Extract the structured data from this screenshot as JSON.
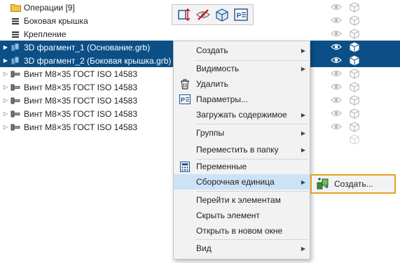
{
  "tree": {
    "rows": [
      {
        "label": "Операции [9]",
        "icon": "folder-icon"
      },
      {
        "label": "Боковая крышка",
        "icon": "list-icon"
      },
      {
        "label": "Крепление",
        "icon": "list-icon"
      },
      {
        "label": "3D фрагмент_1 (Основание.grb)",
        "icon": "fragment-3d-icon"
      },
      {
        "label": "3D фрагмент_2 (Боковая крышка.grb)",
        "icon": "fragment-3d-icon"
      },
      {
        "label": "Винт M8×35 ГОСТ ISO 14583",
        "icon": "screw-icon"
      },
      {
        "label": "Винт M8×35 ГОСТ ISO 14583",
        "icon": "screw-icon"
      },
      {
        "label": "Винт M8×35 ГОСТ ISO 14583",
        "icon": "screw-icon"
      },
      {
        "label": "Винт M8×35 ГОСТ ISO 14583",
        "icon": "screw-icon"
      },
      {
        "label": "Винт M8×35 ГОСТ ISO 14583",
        "icon": "screw-icon"
      }
    ]
  },
  "toolbar": {
    "buttons": [
      "transform-icon",
      "hide-icon",
      "cube-view-icon",
      "parameters-icon"
    ]
  },
  "context_menu": {
    "items": {
      "create": "Создать",
      "visibility": "Видимость",
      "delete": "Удалить",
      "parameters": "Параметры...",
      "load_contents": "Загружать содержимое",
      "groups": "Группы",
      "move_to_folder": "Переместить в папку",
      "variables": "Переменные",
      "assembly_unit": "Сборочная единица",
      "goto_elements": "Перейти к элементам",
      "hide_element": "Скрыть элемент",
      "open_new_window": "Открыть в новом окне",
      "view": "Вид"
    }
  },
  "submenu": {
    "create": "Создать..."
  },
  "colors": {
    "selection": "#0b4f86",
    "menu_highlight": "#cce3f7",
    "submenu_border": "#e6a124"
  }
}
